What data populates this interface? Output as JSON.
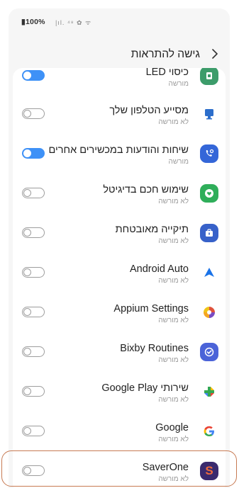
{
  "status_bar": {
    "battery": "100%",
    "icons": "|ıl. ⁴⁸ ✿ ᯤ"
  },
  "header": {
    "title": "גישה להתראות",
    "back_icon": "chevron-right-icon"
  },
  "rows": [
    {
      "label": "כיסוי LED",
      "sub": "מורשה",
      "toggle": "on",
      "icon": "led-cover-icon",
      "icon_color": "#2e8b57"
    },
    {
      "label": "מסייע הטלפון שלך",
      "sub": "לא מורשה",
      "toggle": "off",
      "icon": "phone-assistant-icon",
      "icon_color": "#2c6ecb"
    },
    {
      "label": "שיחות והודעות במכשירים אחרים",
      "sub": "מורשה",
      "toggle": "on",
      "icon": "call-message-continuity-icon",
      "icon_color": "#3466d8"
    },
    {
      "label": "שימוש חכם בדיגיטל",
      "sub": "לא מורשה",
      "toggle": "off",
      "icon": "digital-wellbeing-icon",
      "icon_color": "#2fae5a"
    },
    {
      "label": "תיקייה מאובטחת",
      "sub": "לא מורשה",
      "toggle": "off",
      "icon": "secure-folder-icon",
      "icon_color": "#3761c9"
    },
    {
      "label": "Android Auto",
      "sub": "לא מורשה",
      "toggle": "off",
      "icon": "android-auto-icon",
      "icon_color": "#1a73e8"
    },
    {
      "label": "Appium Settings",
      "sub": "לא מורשה",
      "toggle": "off",
      "icon": "appium-icon",
      "icon_color": "#d9534f"
    },
    {
      "label": "Bixby Routines",
      "sub": "לא מורשה",
      "toggle": "off",
      "icon": "bixby-routines-icon",
      "icon_color": "#4b63d8"
    },
    {
      "label": "שירותי Google Play",
      "sub": "לא מורשה",
      "toggle": "off",
      "icon": "google-play-services-icon",
      "icon_color": "#34a853"
    },
    {
      "label": "Google",
      "sub": "לא מורשה",
      "toggle": "off",
      "icon": "google-icon",
      "icon_color": "#4285f4"
    },
    {
      "label": "SaverOne",
      "sub": "לא מורשה",
      "toggle": "off",
      "icon": "saverone-icon",
      "icon_color": "#3a2a6e"
    }
  ]
}
